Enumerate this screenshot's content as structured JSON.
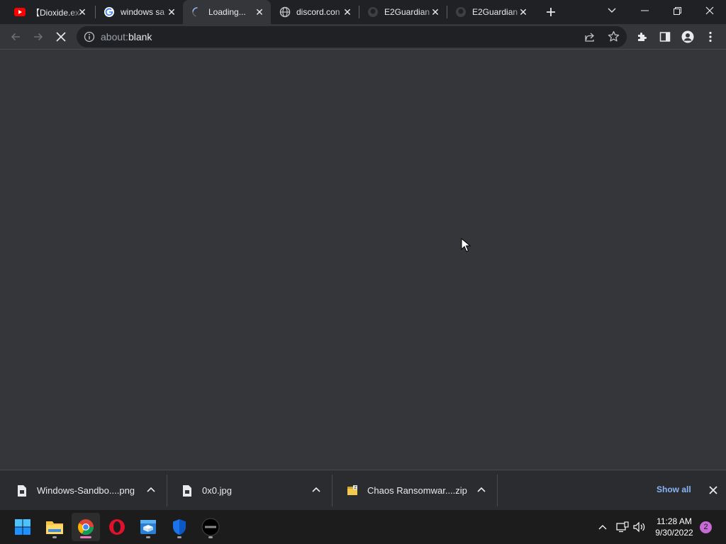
{
  "browser": {
    "tabs": [
      {
        "title": "【Dioxide.ex",
        "icon": "youtube-icon"
      },
      {
        "title": "windows sa",
        "icon": "google-icon"
      },
      {
        "title": "Loading...",
        "icon": "loading-spinner-icon",
        "active": true
      },
      {
        "title": "discord.con",
        "icon": "globe-icon"
      },
      {
        "title": "E2Guardian",
        "icon": "github-icon"
      },
      {
        "title": "E2Guardian",
        "icon": "github-icon"
      }
    ],
    "tab_close_glyph": "✕",
    "new_tab_icon": "plus-icon",
    "address": {
      "scheme": "about:",
      "rest": "blank"
    }
  },
  "downloads": {
    "items": [
      {
        "name": "Windows-Sandbo....png",
        "icon": "image-file-icon"
      },
      {
        "name": "0x0.jpg",
        "icon": "image-file-icon"
      },
      {
        "name": "Chaos Ransomwar....zip",
        "icon": "zip-file-icon"
      }
    ],
    "show_all_label": "Show all"
  },
  "taskbar": {
    "apps": [
      {
        "name": "start-button",
        "icon": "windows-logo-icon"
      },
      {
        "name": "taskbar-file-explorer",
        "icon": "folder-icon"
      },
      {
        "name": "taskbar-chrome",
        "icon": "chrome-icon",
        "active": true
      },
      {
        "name": "taskbar-opera",
        "icon": "opera-icon"
      },
      {
        "name": "taskbar-sandbox",
        "icon": "sandbox-icon"
      },
      {
        "name": "taskbar-defender",
        "icon": "shield-icon"
      },
      {
        "name": "taskbar-chaos",
        "icon": "chaos-icon"
      }
    ],
    "clock": {
      "time": "11:28 AM",
      "date": "9/30/2022"
    },
    "notification_count": "2"
  },
  "colors": {
    "accent": "#8ab4f8",
    "tabstrip_bg": "#202124",
    "toolbar_bg": "#35363a",
    "taskbar_bg": "#1c1c1c"
  }
}
